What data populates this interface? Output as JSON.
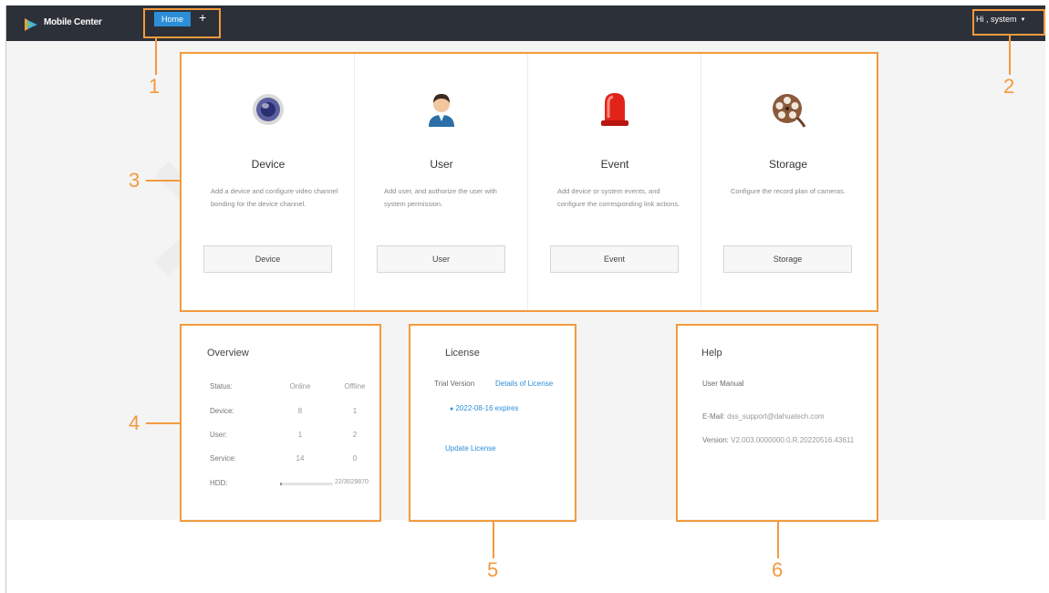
{
  "app": {
    "title": "Mobile Center"
  },
  "tabs": {
    "home": "Home",
    "add": "+"
  },
  "user_menu": {
    "label": "Hi , system",
    "caret": "▼"
  },
  "cards": [
    {
      "title": "Device",
      "desc": "Add a device and configure video channel bonding for the device channel.",
      "button": "Device",
      "icon": "camera-icon"
    },
    {
      "title": "User",
      "desc": "Add user, and authorize the user with system permission.",
      "button": "User",
      "icon": "user-icon"
    },
    {
      "title": "Event",
      "desc": "Add device or system events, and configure the corresponding link actions.",
      "button": "Event",
      "icon": "alarm-light-icon"
    },
    {
      "title": "Storage",
      "desc": "Configure the record plan of cameras.",
      "button": "Storage",
      "icon": "film-reel-icon"
    }
  ],
  "overview": {
    "title": "Overview",
    "headers": {
      "status": "Status:",
      "online": "Online",
      "offline": "Offline"
    },
    "rows": [
      {
        "label": "Device:",
        "online": "8",
        "offline": "1"
      },
      {
        "label": "User:",
        "online": "1",
        "offline": "2"
      },
      {
        "label": "Service:",
        "online": "14",
        "offline": "0"
      }
    ],
    "hdd": {
      "label": "HDD:",
      "value": "22/3029870",
      "used_fraction": 0.03
    }
  },
  "license": {
    "title": "License",
    "version": "Trial Version",
    "details_link": "Details of License",
    "expires": "2022-08-16 expires",
    "update_link": "Update License"
  },
  "help": {
    "title": "Help",
    "manual": "User Manual",
    "email_label": "E-Mail:",
    "email": "dss_support@dahuatech.com",
    "version_label": "Version:",
    "version": "V2.003.0000000.0.R.20220516.43611"
  },
  "callouts": [
    "1",
    "2",
    "3",
    "4",
    "5",
    "6"
  ],
  "colors": {
    "topbar": "#2c3038",
    "accent": "#2d8ed8",
    "callout": "#f39a3d"
  }
}
